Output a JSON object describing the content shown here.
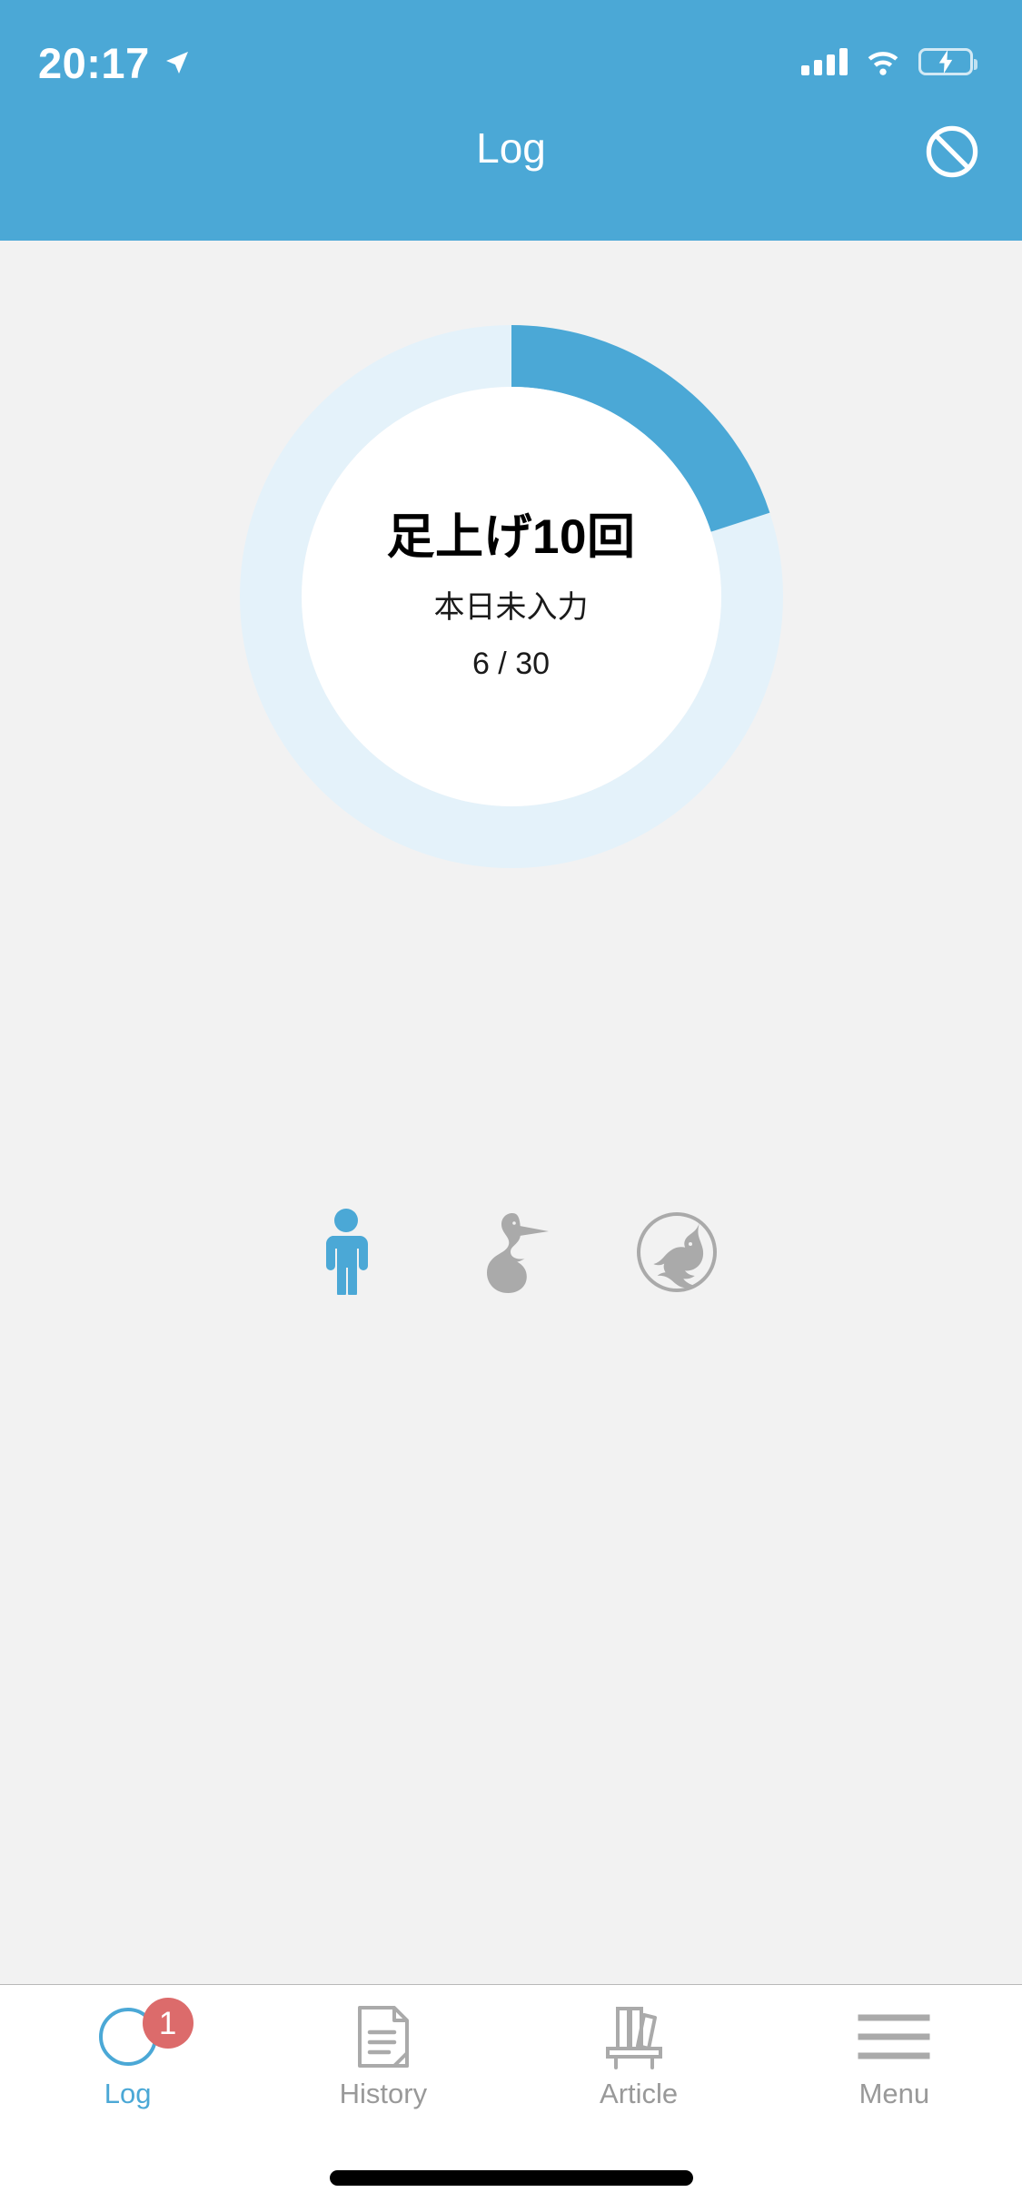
{
  "status_bar": {
    "time": "20:17",
    "location_icon": "location-arrow-icon",
    "signal_icon": "cellular-signal-icon",
    "wifi_icon": "wifi-icon",
    "battery_icon": "battery-charging-icon",
    "battery_color": "#4cd964"
  },
  "header": {
    "title": "Log",
    "background_color": "#4ba8d6",
    "right_action": {
      "icon": "prohibited-circle-icon",
      "label": "Disable"
    }
  },
  "progress_ring": {
    "title": "足上げ10回",
    "subtitle": "本日未入力",
    "count_label": "6 / 30",
    "current": 6,
    "total": 30,
    "percent": 20,
    "track_color": "#e4f2fa",
    "progress_color": "#4ba8d6",
    "inner_color": "#ffffff"
  },
  "achievements": [
    {
      "icon": "person-standing-icon",
      "state": "active",
      "color": "#4ba8d6"
    },
    {
      "icon": "bird-pelican-icon",
      "state": "inactive",
      "color": "#aaaaaa"
    },
    {
      "icon": "wolf-howling-circle-icon",
      "state": "inactive",
      "color": "#aaaaaa"
    }
  ],
  "tab_bar": {
    "active_color": "#4ba8d6",
    "inactive_color": "#999999",
    "badge_color": "#dc6b6b",
    "tabs": [
      {
        "label": "Log",
        "icon": "circle-ring-icon",
        "active": true,
        "badge": "1"
      },
      {
        "label": "History",
        "icon": "document-page-icon",
        "active": false,
        "badge": null
      },
      {
        "label": "Article",
        "icon": "bookshelf-icon",
        "active": false,
        "badge": null
      },
      {
        "label": "Menu",
        "icon": "hamburger-menu-icon",
        "active": false,
        "badge": null
      }
    ]
  }
}
